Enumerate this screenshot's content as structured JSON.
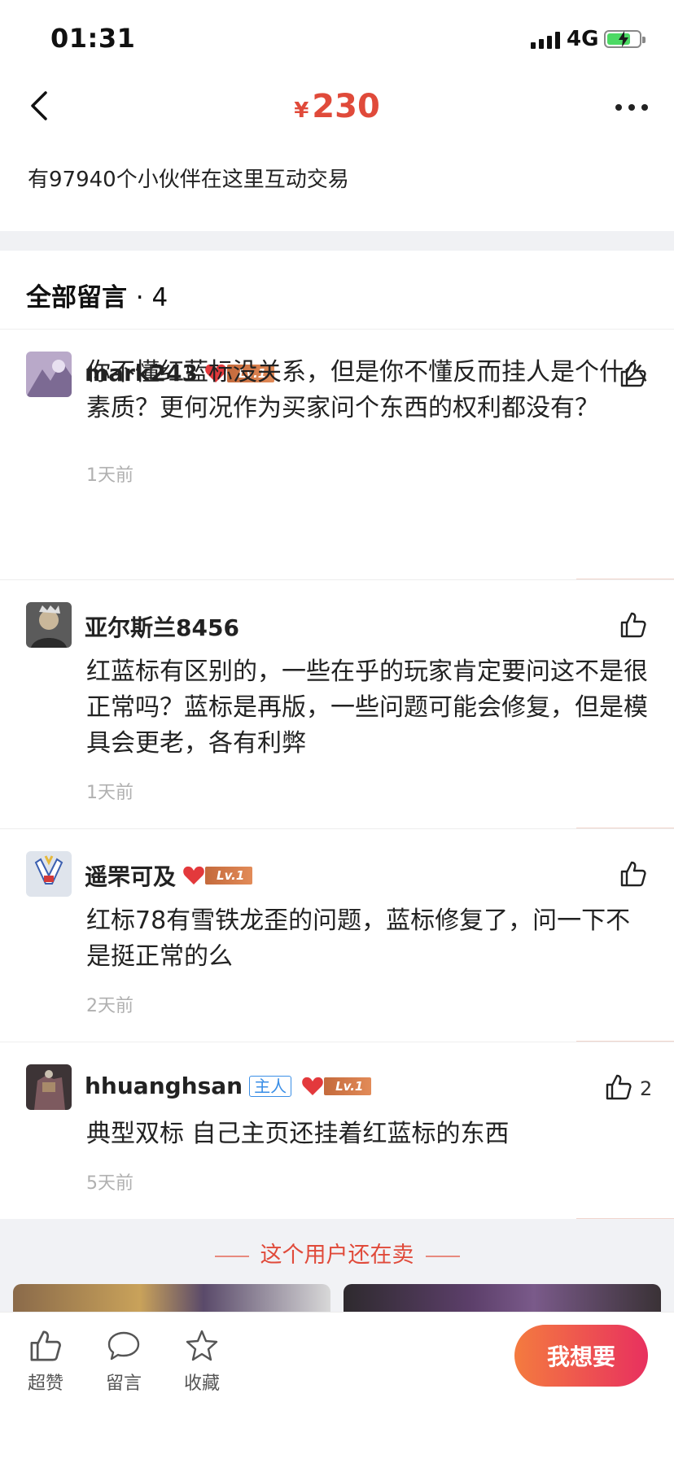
{
  "status_bar": {
    "time": "01:31",
    "network": "4G"
  },
  "header": {
    "currency": "¥",
    "price": "230"
  },
  "interaction_text": "有97940个小伙伴在这里互动交易",
  "comments_section": {
    "title": "全部留言",
    "count": "· 4"
  },
  "comments": [
    {
      "user": "mark243",
      "level": "Lv.1",
      "text": "你不懂红蓝标没关系，但是你不懂反而挂人是个什么素质？更何况作为买家问个东西的权利都没有？",
      "time": "1天前"
    },
    {
      "user": "亚尔斯兰8456",
      "text": "红蓝标有区别的，一些在乎的玩家肯定要问这不是很正常吗？蓝标是再版，一些问题可能会修复，但是模具会更老，各有利弊",
      "time": "1天前"
    },
    {
      "user": "遥罘可及",
      "level": "Lv.1",
      "text": "红标78有雪铁龙歪的问题，蓝标修复了，问一下不是挺正常的么",
      "time": "2天前"
    },
    {
      "user": "hhuanghsan",
      "owner_badge": "主人",
      "level": "Lv.1",
      "text": "典型双标 自己主页还挂着红蓝标的东西",
      "time": "5天前",
      "likes": "2"
    }
  ],
  "selling": {
    "title": "这个用户还在卖"
  },
  "bottom_bar": {
    "like_label": "超赞",
    "comment_label": "留言",
    "fav_label": "收藏",
    "want_label": "我想要"
  },
  "colors": {
    "accent": "#e04a3a",
    "owner_badge": "#3a8ee6",
    "want_gradient_start": "#f47b3f",
    "want_gradient_end": "#e8305f"
  },
  "icons": [
    "back-arrow-icon",
    "more-icon",
    "heart-icon",
    "thumbs-up-icon",
    "speech-bubble-icon",
    "star-icon"
  ]
}
